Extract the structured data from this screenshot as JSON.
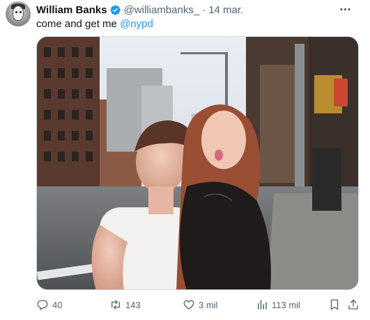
{
  "tweet": {
    "author_name": "William Banks",
    "handle": "@williambanks_",
    "separator": "·",
    "date": "14 mar.",
    "text_prefix": "come and get me ",
    "mention": "@nypd"
  },
  "actions": {
    "replies": "40",
    "retweets": "143",
    "likes": "3 mil",
    "views": "113 mil"
  },
  "colors": {
    "accent": "#1d9bf0",
    "secondary_text": "#536471",
    "primary_text": "#0f1419"
  },
  "icons": [
    "verified-badge-icon",
    "more-options-icon",
    "reply-icon",
    "retweet-icon",
    "like-icon",
    "views-icon",
    "bookmark-icon",
    "share-icon"
  ]
}
